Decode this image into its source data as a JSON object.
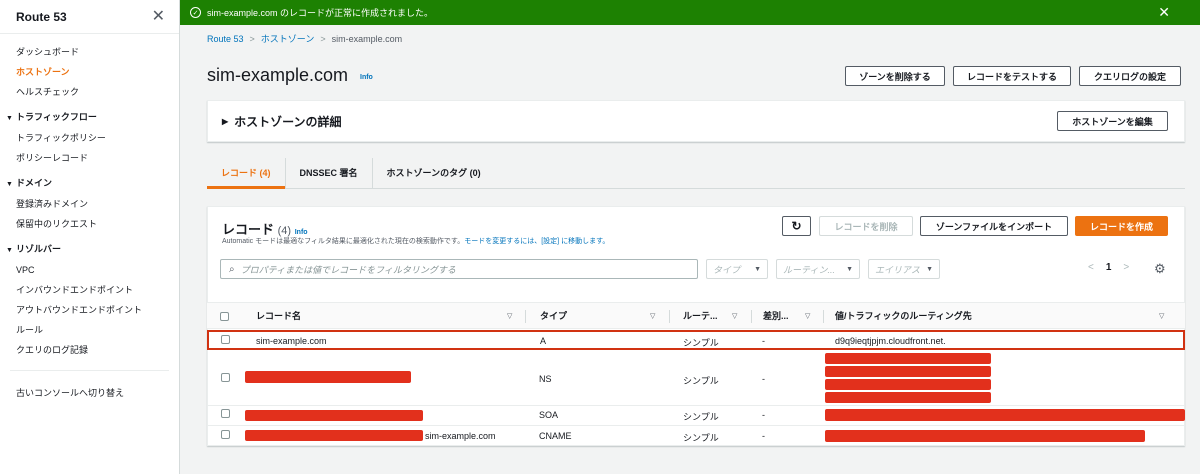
{
  "sidebar": {
    "title": "Route 53",
    "items_top": [
      "ダッシュボード",
      "ホストゾーン",
      "ヘルスチェック"
    ],
    "groups": [
      {
        "label": "トラフィックフロー",
        "items": [
          "トラフィックポリシー",
          "ポリシーレコード"
        ]
      },
      {
        "label": "ドメイン",
        "items": [
          "登録済みドメイン",
          "保留中のリクエスト"
        ]
      },
      {
        "label": "リゾルバー",
        "items": [
          "VPC",
          "インバウンドエンドポイント",
          "アウトバウンドエンドポイント",
          "ルール",
          "クエリのログ記録"
        ]
      }
    ],
    "footer_link": "古いコンソールへ切り替え"
  },
  "flash": {
    "message": "sim-example.com のレコードが正常に作成されました。",
    "color": "#1d8102"
  },
  "breadcrumb": {
    "root": "Route 53",
    "section": "ホストゾーン",
    "current": "sim-example.com"
  },
  "header": {
    "title": "sim-example.com",
    "info": "Info",
    "delete_zone": "ゾーンを削除する",
    "test_record": "レコードをテストする",
    "query_log": "クエリログの設定"
  },
  "details": {
    "title": "ホストゾーンの詳細",
    "edit": "ホストゾーンを編集"
  },
  "tabs": [
    "レコード (4)",
    "DNSSEC 署名",
    "ホストゾーンのタグ (0)"
  ],
  "records": {
    "title": "レコード",
    "count": "(4)",
    "info": "Info",
    "desc_prefix": "Automatic モードは最適なフィルタ結果に最適化された現在の検索動作です。",
    "desc_link": "モードを変更するには、[設定] に移動します。",
    "delete": "レコードを削除",
    "import": "ゾーンファイルをインポート",
    "create": "レコードを作成",
    "filter_placeholder": "プロパティまたは値でレコードをフィルタリングする",
    "type_filter": "タイプ",
    "routing_filter": "ルーティン...",
    "alias_filter": "エイリアス",
    "page": "1"
  },
  "table": {
    "headers": [
      "レコード名",
      "タイプ",
      "ルーテ...",
      "差別...",
      "値/トラフィックのルーティング先"
    ],
    "rows": [
      {
        "name": "sim-example.com",
        "type": "A",
        "routing": "シンプル",
        "diff": "-",
        "value": "d9q9ieqtjpjm.cloudfront.net."
      },
      {
        "name": "",
        "type": "NS",
        "routing": "シンプル",
        "diff": "-",
        "value": ""
      },
      {
        "name": "",
        "type": "SOA",
        "routing": "シンプル",
        "diff": "-",
        "value": ""
      },
      {
        "name": "sim-example.com",
        "type": "CNAME",
        "routing": "シンプル",
        "diff": "-",
        "value": ""
      }
    ]
  }
}
